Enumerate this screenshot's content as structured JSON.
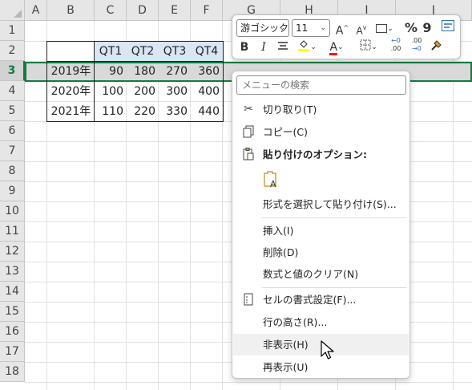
{
  "columns": [
    "A",
    "B",
    "C",
    "D",
    "E",
    "F",
    "G",
    "H",
    "I",
    "J"
  ],
  "rows": [
    "1",
    "2",
    "3",
    "4",
    "5",
    "6",
    "7",
    "8",
    "9",
    "10",
    "11",
    "12",
    "13",
    "14",
    "15",
    "16",
    "17",
    "18"
  ],
  "selected_row": "3",
  "table": {
    "headers": [
      "QT1",
      "QT2",
      "QT3",
      "QT4"
    ],
    "rows": [
      {
        "label": "2019年",
        "values": [
          "90",
          "180",
          "270",
          "360"
        ]
      },
      {
        "label": "2020年",
        "values": [
          "100",
          "200",
          "300",
          "400"
        ]
      },
      {
        "label": "2021年",
        "values": [
          "110",
          "220",
          "330",
          "440"
        ]
      }
    ]
  },
  "mini_toolbar": {
    "font_name": "游ゴシック",
    "font_size": "11",
    "increase_font": "A",
    "decrease_font": "A",
    "percent": "%",
    "comma": "9",
    "bold": "B",
    "italic": "I",
    "fill_letter": "A",
    "font_color_letter": "A",
    "inc_decimal_top": "←0",
    "inc_decimal_bottom": ".00",
    "dec_decimal_top": ".00",
    "dec_decimal_bottom": "→0",
    "accent_yellow": "#ffff00",
    "accent_red": "#ff0000"
  },
  "menu": {
    "search_placeholder": "メニューの検索",
    "items": [
      {
        "label": "切り取り(T)",
        "icon": "scissors-icon"
      },
      {
        "label": "コピー(C)",
        "icon": "copy-icon"
      },
      {
        "label": "貼り付けのオプション:",
        "icon": "paste-icon"
      },
      {
        "label": "形式を選択して貼り付け(S)..."
      },
      {
        "label": "挿入(I)"
      },
      {
        "label": "削除(D)"
      },
      {
        "label": "数式と値のクリア(N)"
      },
      {
        "label": "セルの書式設定(F)...",
        "icon": "format-cells-icon"
      },
      {
        "label": "行の高さ(R)..."
      },
      {
        "label": "非表示(H)"
      },
      {
        "label": "再表示(U)"
      }
    ]
  },
  "colors": {
    "excel_green": "#107c41",
    "header_bg": "#e6e6e6",
    "qt_header_bg": "#d9e6f4",
    "selected_row_bg": "#d9d9d9"
  }
}
